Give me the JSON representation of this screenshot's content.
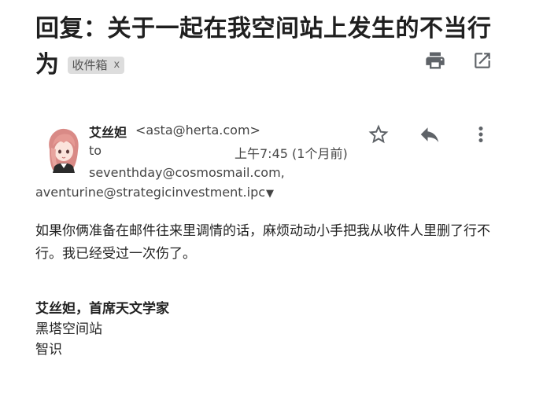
{
  "email": {
    "subject_line1": "回复：关于一起在我空间站上发生的不当行",
    "subject_line2": "为",
    "label": "收件箱",
    "label_remove": "x",
    "sender_name": "艾丝妲",
    "sender_email": "<asta@herta.com>",
    "to_label": "to",
    "datetime": "上午7:45 (1个月前)",
    "recipient_1": "seventhday@cosmosmail.com,",
    "recipient_2": "aventurine@strategicinvestment.ipc",
    "expand_arrow": "▼",
    "body": "如果你俩准备在邮件往来里调情的话，麻烦动动小手把我从收件人里删了行不行。我已经受过一次伤了。",
    "signature": {
      "name_title": "艾丝妲，首席天文学家",
      "org": "黑塔空间站",
      "dept": "智识"
    }
  },
  "icons": {
    "print": "print-icon",
    "open_new": "open-in-new-icon",
    "star": "star-icon",
    "reply": "reply-icon",
    "more": "more-vert-icon"
  },
  "colors": {
    "icon": "#5f6368",
    "chip_bg": "#dddddd",
    "text": "#202124"
  }
}
